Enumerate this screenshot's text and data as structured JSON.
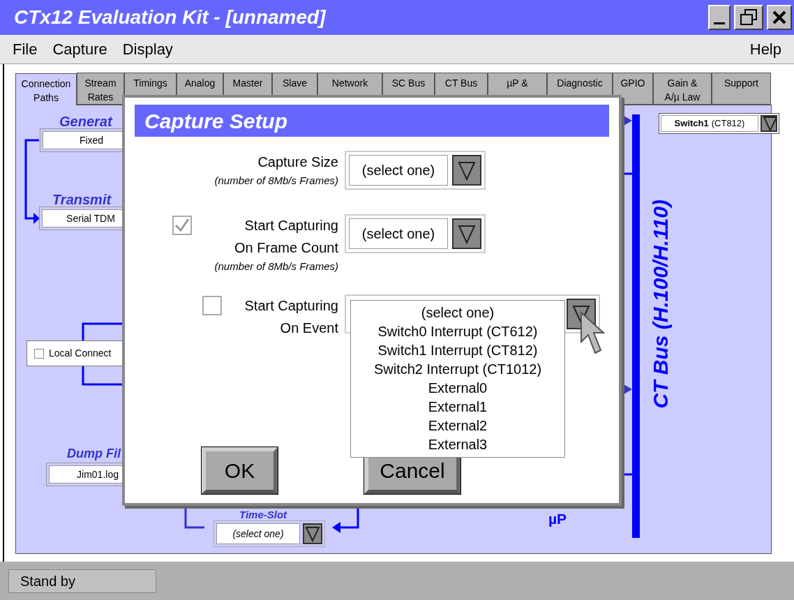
{
  "window": {
    "title": "CTx12 Evaluation Kit - [unnamed]"
  },
  "menu": [
    {
      "label": "File"
    },
    {
      "label": "Capture"
    },
    {
      "label": "Display"
    }
  ],
  "help_menu": {
    "label": "Help"
  },
  "tabs": [
    {
      "lines": [
        "Connection",
        "Paths"
      ],
      "selected": true
    },
    {
      "lines": [
        "Stream",
        "Rates"
      ],
      "selected": false
    },
    {
      "lines": [
        "Timings"
      ],
      "selected": false
    },
    {
      "lines": [
        "Analog"
      ],
      "selected": false
    },
    {
      "lines": [
        "Master"
      ],
      "selected": false
    },
    {
      "lines": [
        "Slave"
      ],
      "selected": false
    },
    {
      "lines": [
        "Network"
      ],
      "selected": false
    },
    {
      "lines": [
        "SC Bus"
      ],
      "selected": false
    },
    {
      "lines": [
        "CT Bus"
      ],
      "selected": false
    },
    {
      "lines": [
        "µP &"
      ],
      "selected": false
    },
    {
      "lines": [
        "Diagnostic"
      ],
      "selected": false
    },
    {
      "lines": [
        "GPIO"
      ],
      "selected": false
    },
    {
      "lines": [
        "Gain &",
        "A/µ Law"
      ],
      "selected": false
    },
    {
      "lines": [
        "Support"
      ],
      "selected": false
    }
  ],
  "diagram": {
    "generator_label": "Generat",
    "generator_value": "Fixed",
    "transmit_label": "Transmit",
    "transmit_value": "Serial TDM",
    "local_connect": {
      "label": "Local Connect",
      "checked": false
    },
    "dump_label": "Dump Fil",
    "dump_value": "Jim01.log",
    "time_slot_label": "Time-Slot",
    "time_slot_value": "(select one)",
    "up_label": "µP",
    "bus_label": "CT Bus (H.100/H.110)",
    "switch_select": {
      "name": "Switch1",
      "model": "(CT812)"
    }
  },
  "dialog": {
    "title": "Capture Setup",
    "rows": [
      {
        "kind": "plain",
        "label_lines": [
          "Capture Size"
        ],
        "sublabel": "(number of 8Mb/s Frames)",
        "value": "(select one)",
        "expanded": false
      },
      {
        "kind": "checkbox",
        "checked": true,
        "label_lines": [
          "Start Capturing",
          "On Frame Count"
        ],
        "sublabel": "(number of 8Mb/s Frames)",
        "value": "(select one)",
        "expanded": false
      },
      {
        "kind": "checkbox",
        "checked": false,
        "label_lines": [
          "Start Capturing",
          "On Event"
        ],
        "expanded": true,
        "options": [
          "(select one)",
          "Switch0 Interrupt (CT612)",
          "Switch1 Interrupt (CT812)",
          "Switch2 Interrupt (CT1012)",
          "External0",
          "External1",
          "External2",
          "External3"
        ]
      }
    ],
    "buttons": [
      "OK",
      "Cancel"
    ]
  },
  "status_bar": {
    "text": "Stand by"
  }
}
